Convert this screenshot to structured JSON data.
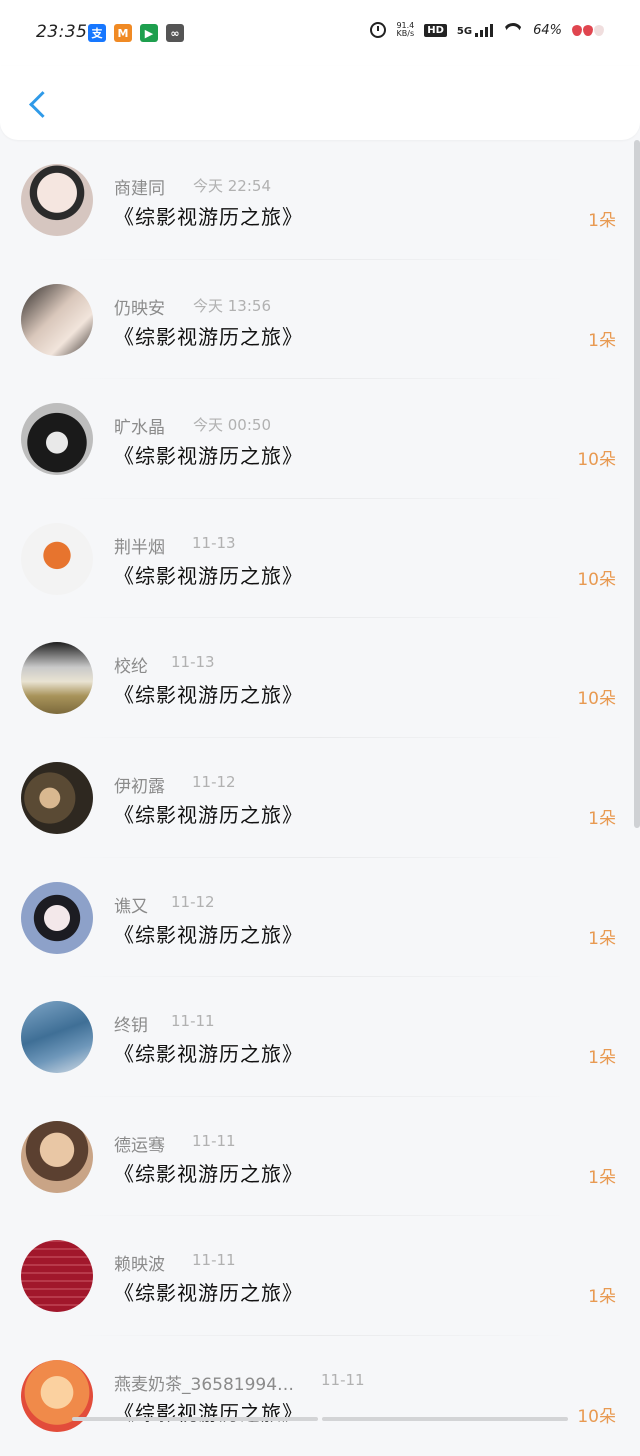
{
  "status_bar": {
    "time": "23:35",
    "app_icons": [
      {
        "name": "alipay-icon",
        "glyph": "支",
        "color": "#1677ff"
      },
      {
        "name": "app-m-icon",
        "glyph": "M",
        "color": "#f08a24"
      },
      {
        "name": "video-app-icon",
        "glyph": "▶",
        "color": "#1e9f4e"
      },
      {
        "name": "link-app-icon",
        "glyph": "∞",
        "color": "#555555"
      }
    ],
    "net_speed_value": "91.4",
    "net_speed_unit": "KB/s",
    "hd_label": "HD",
    "network_label": "5G",
    "battery": "64%"
  },
  "header": {
    "back_icon": "chevron-left-icon",
    "accent_color": "#2f9ae8"
  },
  "list": {
    "items": [
      {
        "name": "商建同",
        "time": "今天 22:54",
        "title": "《综影视游历之旅》",
        "count": "1朵",
        "avatar_bg": "radial-gradient(circle at 50% 40%, #f5e6e0 0 35%, #2b2b2b 36% 48%, #d6c6c0 49% 100%)"
      },
      {
        "name": "仍映安",
        "time": "今天 13:56",
        "title": "《综影视游历之旅》",
        "count": "1朵",
        "avatar_bg": "linear-gradient(135deg, #2e2a28 0%, #d9c7bb 45%, #f1e4db 70%, #3a322e 100%)"
      },
      {
        "name": "旷水晶",
        "time": "今天 00:50",
        "title": "《综影视游历之旅》",
        "count": "10朵",
        "avatar_bg": "radial-gradient(circle at 50% 55%, #e9e9e9 0 20%, #1a1a1a 21% 55%, #bdbdbd 56% 100%)"
      },
      {
        "name": "荆半烟",
        "time": "11-13",
        "title": "《综影视游历之旅》",
        "count": "10朵",
        "avatar_bg": "radial-gradient(circle at 50% 45%, #e7742e 0 25%, #f3f3f3 26% 100%)"
      },
      {
        "name": "校纶",
        "time": "11-13",
        "title": "《综影视游历之旅》",
        "count": "10朵",
        "avatar_bg": "linear-gradient(180deg, #1f1f1f 0%, #c9c9c9 35%, #e9e3d2 55%, #a8935a 75%, #7c6a3c 100%)"
      },
      {
        "name": "伊初露",
        "time": "11-12",
        "title": "《综影视游历之旅》",
        "count": "1朵",
        "avatar_bg": "radial-gradient(circle at 40% 50%, #d9b890 0 18%, #5a4a34 19% 45%, #2e2820 46% 100%)"
      },
      {
        "name": "谯又",
        "time": "11-12",
        "title": "《综影视游历之旅》",
        "count": "1朵",
        "avatar_bg": "radial-gradient(circle at 50% 50%, #f3e8ea 0 25%, #1c1c22 26% 45%, #8da1c9 46% 100%)"
      },
      {
        "name": "终钥",
        "time": "11-11",
        "title": "《综影视游历之旅》",
        "count": "1朵",
        "avatar_bg": "linear-gradient(160deg, #7fa6c7 0%, #3f6f96 45%, #6e97ba 70%, #d4dde6 100%)"
      },
      {
        "name": "德运骞",
        "time": "11-11",
        "title": "《综影视游历之旅》",
        "count": "1朵",
        "avatar_bg": "radial-gradient(circle at 50% 40%, #e9c7a5 0 30%, #5b4030 31% 55%, #c9a486 56% 100%)"
      },
      {
        "name": "赖映波",
        "time": "11-11",
        "title": "《综影视游历之旅》",
        "count": "1朵",
        "avatar_bg": "repeating-linear-gradient(0deg, #a1172b 0 6px, #b8394a 6px 8px)"
      },
      {
        "name": "燕麦奶茶_36581994…",
        "time": "11-11",
        "title": "《综影视游历之旅》",
        "count": "10朵",
        "avatar_bg": "radial-gradient(circle at 50% 45%, #fbd1a0 0 30%, #f08a4a 31% 60%, #e24c3a 61% 100%)"
      }
    ]
  },
  "colors": {
    "name_text": "#8b8b8b",
    "time_text": "#b1b1b1",
    "title_text": "#111111",
    "count_text": "#e89a52",
    "background": "#f6f7f9"
  }
}
